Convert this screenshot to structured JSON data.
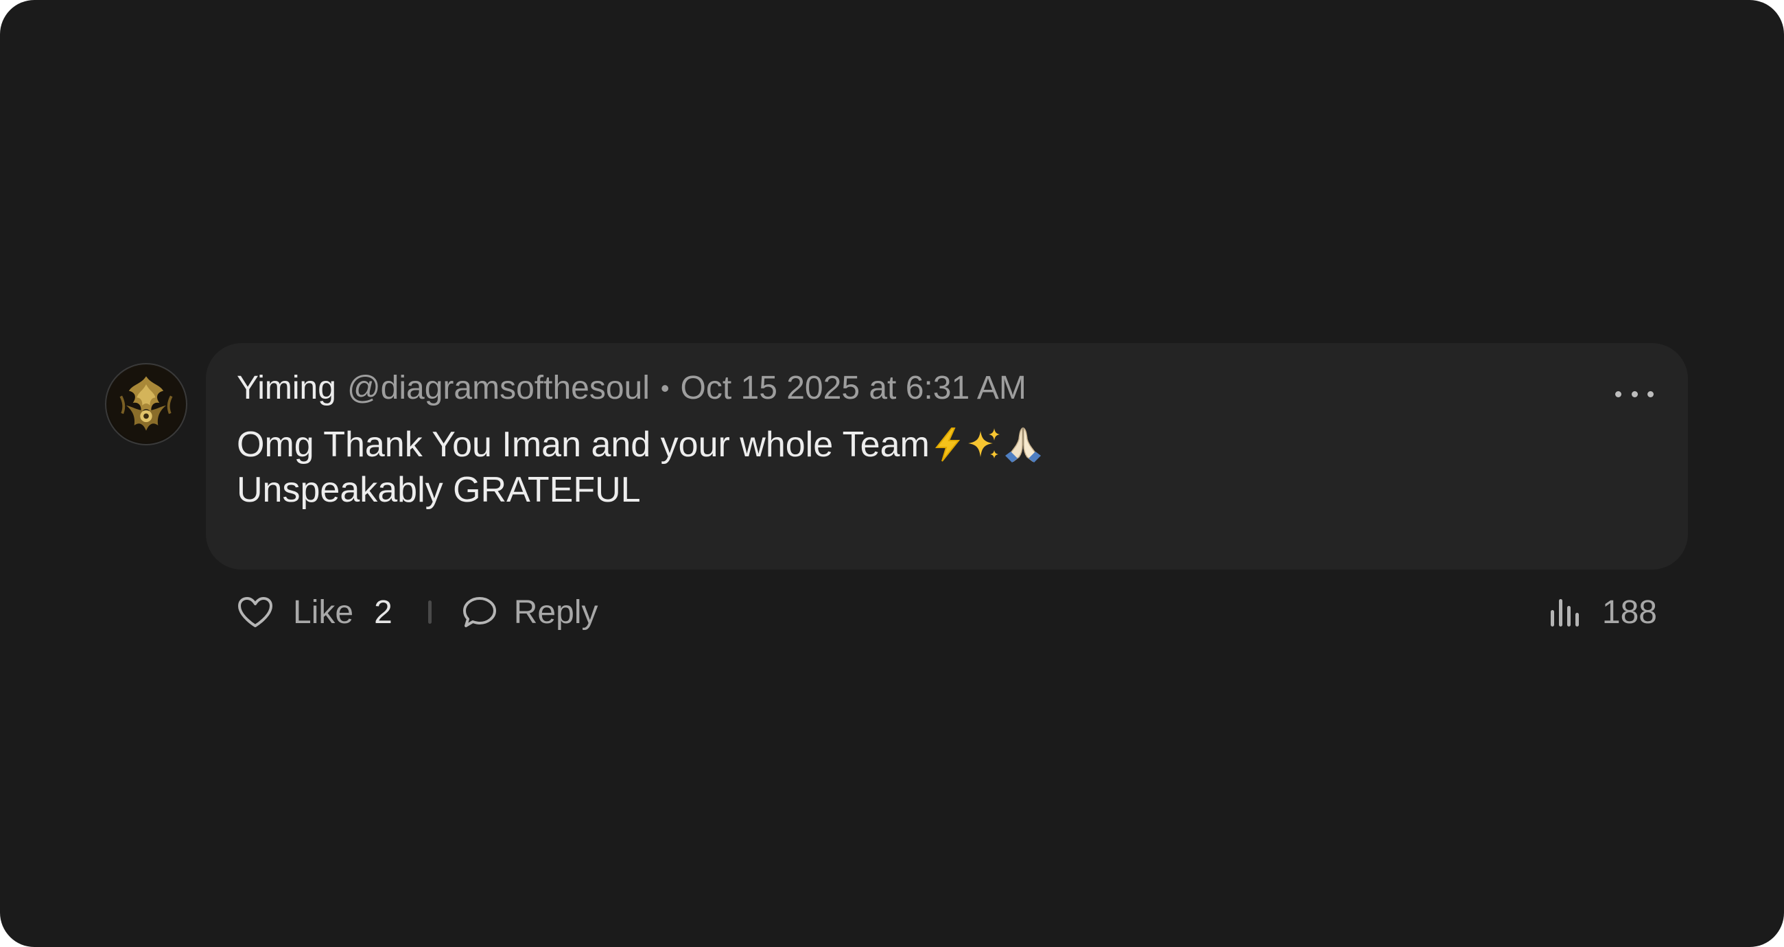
{
  "comment": {
    "author_name": "Yiming",
    "author_handle": "@diagramsofthesoul",
    "separator": "•",
    "timestamp": "Oct 15 2025 at 6:31 AM",
    "text_line1": "Omg Thank You Iman and your whole Team",
    "emojis": [
      "high-voltage",
      "sparkles",
      "folded-hands"
    ],
    "text_line2": "Unspeakably GRATEFUL"
  },
  "actions": {
    "like_label": "Like",
    "like_count": "2",
    "reply_label": "Reply",
    "views_count": "188"
  },
  "colors": {
    "background": "#1b1b1b",
    "bubble": "#242424",
    "primary_text": "#ececec",
    "secondary_text": "#9e9e9e"
  },
  "icons": {
    "more": "ellipsis-icon",
    "like": "heart-icon",
    "reply": "speech-bubble-icon",
    "views": "bar-chart-icon"
  }
}
